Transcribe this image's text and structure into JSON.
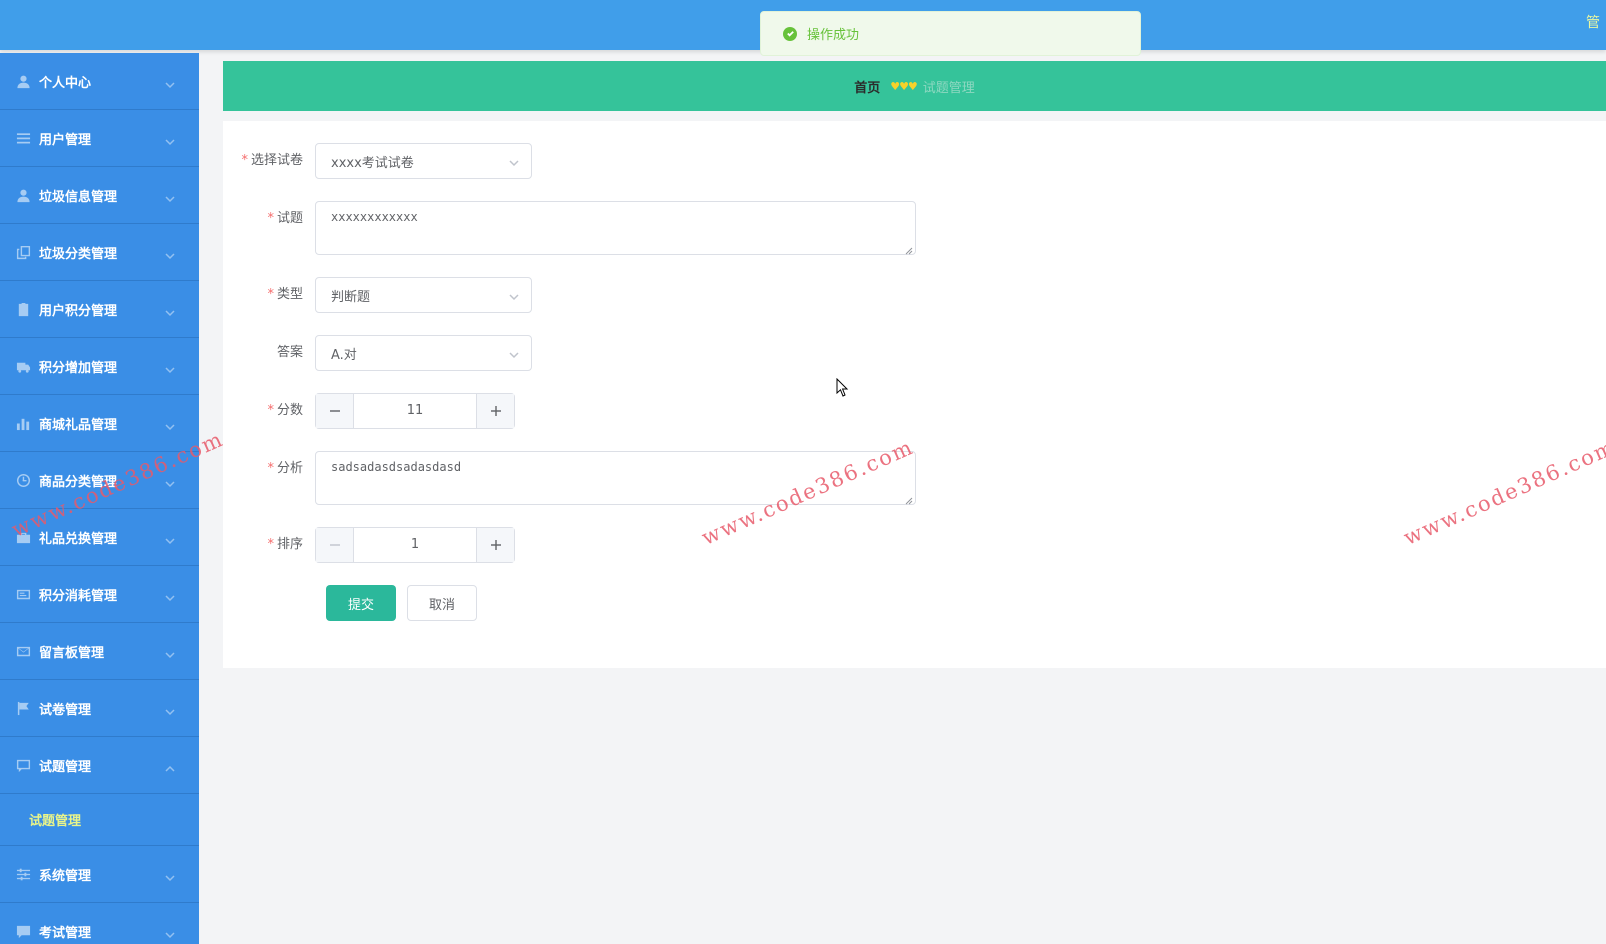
{
  "header": {
    "right_text": "管"
  },
  "toast": {
    "message": "操作成功",
    "icon": "check-circle-icon",
    "color": "#67c23a"
  },
  "breadcrumb": {
    "home": "首页",
    "separator": "♥♥♥",
    "current": "试题管理"
  },
  "sidebar": {
    "items": [
      {
        "label": "个人中心",
        "icon": "user-icon"
      },
      {
        "label": "用户管理",
        "icon": "list-icon"
      },
      {
        "label": "垃圾信息管理",
        "icon": "user-icon"
      },
      {
        "label": "垃圾分类管理",
        "icon": "copy-icon"
      },
      {
        "label": "用户积分管理",
        "icon": "clipboard-icon"
      },
      {
        "label": "积分增加管理",
        "icon": "truck-icon"
      },
      {
        "label": "商城礼品管理",
        "icon": "bar-chart-icon"
      },
      {
        "label": "商品分类管理",
        "icon": "clock-icon"
      },
      {
        "label": "礼品兑换管理",
        "icon": "briefcase-icon"
      },
      {
        "label": "积分消耗管理",
        "icon": "card-icon"
      },
      {
        "label": "留言板管理",
        "icon": "mail-icon"
      },
      {
        "label": "试卷管理",
        "icon": "flag-icon"
      },
      {
        "label": "试题管理",
        "icon": "message-icon"
      },
      {
        "label": "系统管理",
        "icon": "sliders-icon"
      },
      {
        "label": "考试管理",
        "icon": "chat-icon"
      }
    ],
    "submenu": {
      "label": "试题管理"
    },
    "colors": {
      "bg": "#3a8ee6",
      "active_text": "#e8f48a"
    }
  },
  "form": {
    "paper": {
      "label": "选择试卷",
      "value": "xxxx考试试卷",
      "required": true
    },
    "question": {
      "label": "试题",
      "value": "xxxxxxxxxxxx",
      "required": true
    },
    "type": {
      "label": "类型",
      "value": "判断题",
      "required": true
    },
    "answer": {
      "label": "答案",
      "value": "A.对",
      "required": false
    },
    "score": {
      "label": "分数",
      "value": "11",
      "required": true
    },
    "analysis": {
      "label": "分析",
      "value": "sadsadasdsadasdasd",
      "required": true
    },
    "order": {
      "label": "排序",
      "value": "1",
      "required": true
    },
    "required_mark": "*",
    "submit_label": "提交",
    "cancel_label": "取消"
  },
  "watermark": {
    "text": "www.code386.com"
  },
  "colors": {
    "header": "#409eea",
    "breadcrumb_bar": "#35c39a",
    "primary_button": "#2bb89b",
    "watermark": "#e85a6a"
  }
}
